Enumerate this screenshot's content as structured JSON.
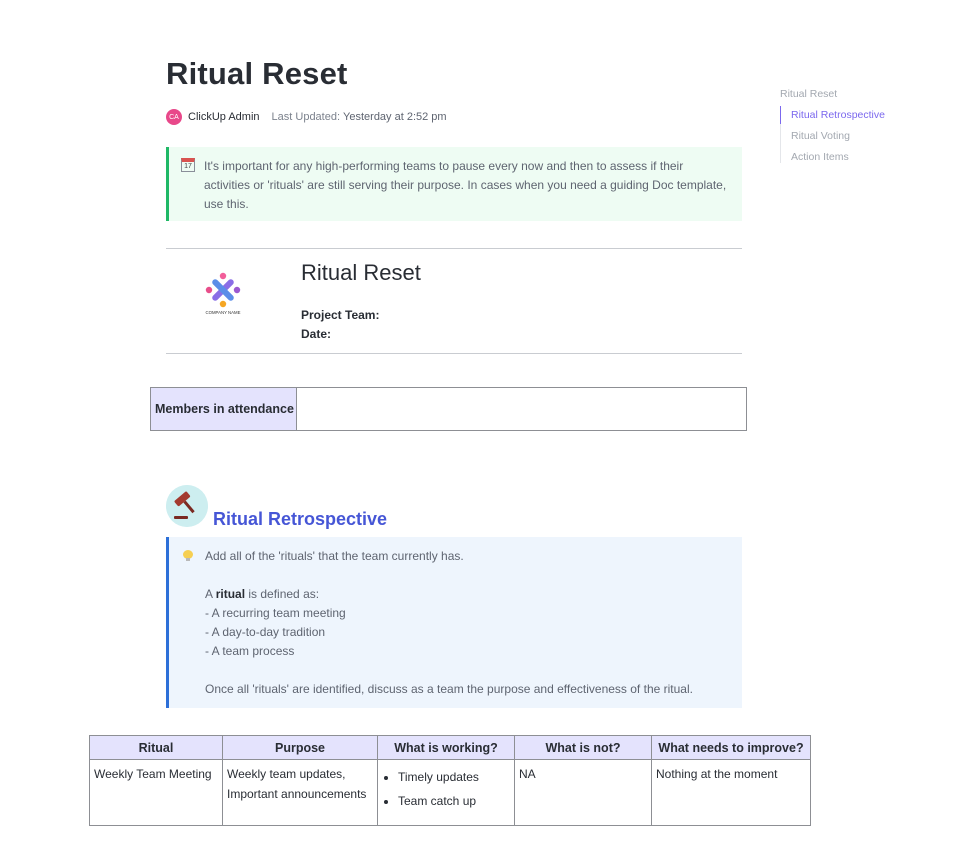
{
  "page": {
    "title": "Ritual Reset",
    "author_initials": "CA",
    "author": "ClickUp Admin",
    "last_updated_label": "Last Updated:",
    "last_updated_value": "Yesterday at 2:52 pm"
  },
  "toc": {
    "heading": "Ritual Reset",
    "items": [
      "Ritual Retrospective",
      "Ritual Voting",
      "Action Items"
    ],
    "active_index": 0
  },
  "intro_callout": {
    "icon": "calendar-icon",
    "icon_day": "17",
    "text": "It's important for any high-performing teams to pause every now and then to assess if their activities or 'rituals' are still serving their purpose. In cases when you need a guiding Doc template, use this."
  },
  "doc_header": {
    "logo_text": "COMPANY NAME",
    "title": "Ritual Reset",
    "project_team_label": "Project Team:",
    "date_label": "Date:"
  },
  "members": {
    "label": "Members in attendance",
    "value": ""
  },
  "retrospective": {
    "title": "Ritual Retrospective",
    "callout": {
      "icon": "lightbulb-icon",
      "line1": "Add all of the 'rituals' that the team currently has.",
      "def_prefix": "A ",
      "def_bold": "ritual",
      "def_suffix": " is defined as:",
      "bullets": [
        "- A recurring team meeting",
        "- A day-to-day tradition",
        "- A team process"
      ],
      "closing": "Once all 'rituals' are identified, discuss as a team the purpose and effectiveness of the ritual."
    }
  },
  "rituals_table": {
    "headers": [
      "Ritual",
      "Purpose",
      "What is working?",
      "What is not?",
      "What needs to improve?"
    ],
    "rows": [
      {
        "ritual": "Weekly Team Meeting",
        "purpose": "Weekly team updates, Important announcements",
        "working": [
          "Timely updates",
          "Team catch up"
        ],
        "not_working": "NA",
        "improve": "Nothing at the moment"
      }
    ]
  },
  "colors": {
    "accent_purple": "#7b68ee",
    "green_callout_border": "#1fb866",
    "blue_callout_border": "#2c6fd8",
    "section_title": "#4656d6",
    "table_header_bg": "#e4e3fd"
  }
}
